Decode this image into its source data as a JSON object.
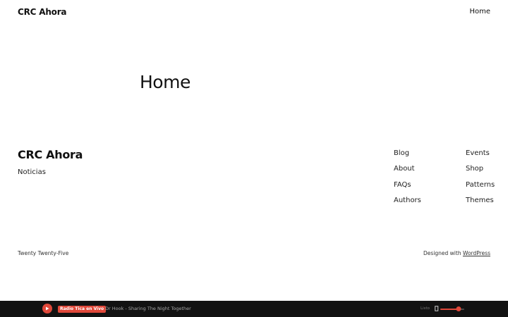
{
  "header": {
    "site_title": "CRC Ahora",
    "nav": [
      {
        "label": "Home"
      }
    ]
  },
  "main": {
    "page_title": "Home"
  },
  "footer": {
    "title": "CRC Ahora",
    "tagline": "Noticias",
    "links_col1": [
      {
        "label": "Blog"
      },
      {
        "label": "About"
      },
      {
        "label": "FAQs"
      },
      {
        "label": "Authors"
      }
    ],
    "links_col2": [
      {
        "label": "Events"
      },
      {
        "label": "Shop"
      },
      {
        "label": "Patterns"
      },
      {
        "label": "Themes"
      }
    ],
    "credit_left": "Twenty Twenty-Five",
    "credit_right_prefix": "Designed with ",
    "credit_right_link": "WordPress"
  },
  "player": {
    "station": "Radio Tica en Vivo",
    "track": "Dr Hook - Sharing The Night Together",
    "volume_label": "Listo",
    "volume_level": 0.75,
    "accent": "#e0483a",
    "background": "#121212"
  },
  "icons": {
    "play": "play-icon",
    "speaker": "speaker-icon"
  }
}
